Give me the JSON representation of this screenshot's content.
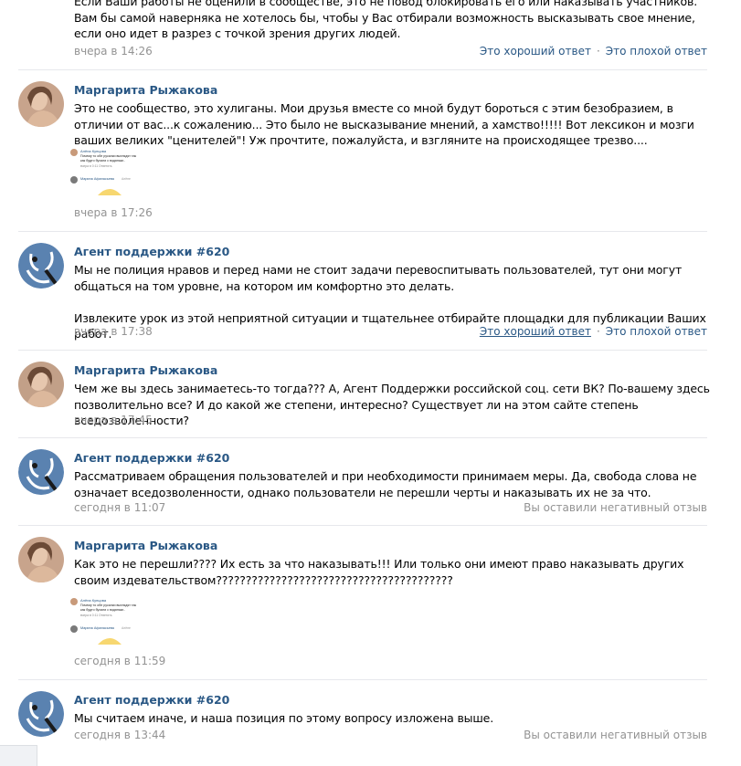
{
  "messages": [
    {
      "author": "",
      "text": "Если Ваши работы не оценили в сообществе, это не повод блокировать его или наказывать участников. Вам бы самой наверняка не хотелось бы, чтобы у Вас отбирали возможность высказывать свое мнение, если оно идет в разрез с точкой зрения других людей.",
      "time": "вчера в 14:26",
      "good": "Это хороший ответ",
      "bad": "Это плохой ответ"
    },
    {
      "author": "Маргарита Рыжакова",
      "text": "Это не сообщество, это хулиганы. Мои друзья вместе со мной будут бороться с этим безобразием, в отличии от вас...к сожалению... Это было не высказывание мнений, а хамство!!!!! Вот лексикон и мозги ваших великих \"ценителей\"! Уж прочтите, пожалуйста, и взгляните на происходящее трезво....",
      "time": "вчера в 17:26",
      "attachment": {
        "name1": "Алёна Купцова",
        "line1": "Почему то обе русалки выглядят так",
        "line2": "как будто бухали с водяным..",
        "meta": "вчера в 0:11  Ответить",
        "name2": "Марина Афанасьева",
        "reply": "Алёне"
      }
    },
    {
      "author": "Агент поддержки #620",
      "text": "Мы не полиция нравов и перед нами не стоит задачи перевоспитывать пользователей, тут они могут общаться на том уровне, на котором им комфортно это делать.\n\nИзвлеките урок из этой неприятной ситуации и тщательнее отбирайте площадки для публикации Ваших работ.",
      "time": "вчера в 17:38",
      "good": "Это хороший ответ",
      "bad": "Это плохой ответ"
    },
    {
      "author": "Маргарита Рыжакова",
      "text": "Чем же вы здесь занимаетесь-то тогда??? А, Агент Поддержки российской соц. сети ВК? По-вашему здесь позволительно все? И до какой же степени, интересно? Существует ли на этом сайте степень вседозволенности?",
      "time": "вчера в 17:45"
    },
    {
      "author": "Агент поддержки #620",
      "text": "Рассматриваем обращения пользователей и при необходимости принимаем меры. Да, свобода слова не означает вседозволенности, однако пользователи не перешли черты и наказывать их не за что.",
      "time": "сегодня в 11:07",
      "feedback": "Вы оставили негативный отзыв"
    },
    {
      "author": "Маргарита Рыжакова",
      "text": "Как это не перешли???? Их есть за что наказывать!!! Или только они имеют право наказывать других своим издевательством????????????????????????????????????????",
      "time": "сегодня в 11:59",
      "attachment": {
        "name1": "Алёна Купцова",
        "line1": "Почему то обе русалки выглядят так",
        "line2": "как будто бухали с водяным..",
        "meta": "вчера в 0:11  Ответить",
        "name2": "Марина Афанасьева",
        "reply": "Алёне"
      }
    },
    {
      "author": "Агент поддержки #620",
      "text": "Мы считаем иначе, и наша позиция по этому вопросу изложена выше.",
      "time": "сегодня в 13:44",
      "feedback": "Вы оставили негативный отзыв"
    }
  ]
}
